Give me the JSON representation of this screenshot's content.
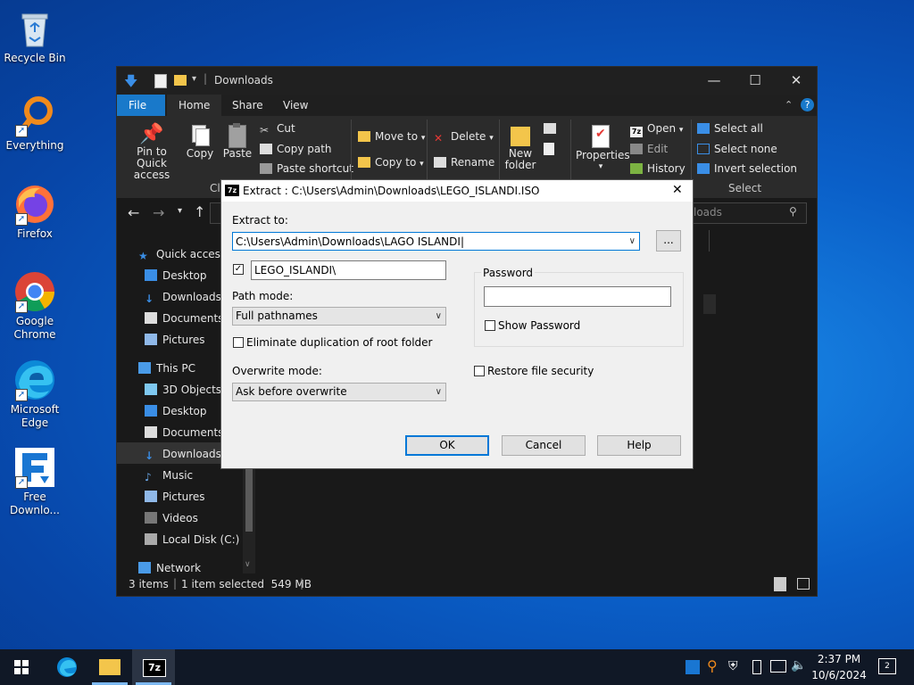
{
  "desktop": {
    "icons": [
      {
        "label": "Recycle Bin",
        "icon": "recycle-bin-icon"
      },
      {
        "label": "Everything",
        "icon": "everything-search-icon"
      },
      {
        "label": "Firefox",
        "icon": "firefox-icon"
      },
      {
        "label": "Google Chrome",
        "icon": "chrome-icon"
      },
      {
        "label": "Microsoft Edge",
        "icon": "edge-icon"
      },
      {
        "label": "Free Downlo...",
        "icon": "free-download-manager-icon"
      }
    ]
  },
  "explorer": {
    "title": "Downloads",
    "tabs": [
      "File",
      "Home",
      "Share",
      "View"
    ],
    "ribbon": {
      "pin_label": "Pin to Quick access",
      "copy_label": "Copy",
      "paste_label": "Paste",
      "cut_label": "Cut",
      "copy_path_label": "Copy path",
      "paste_shortcut_label": "Paste shortcut",
      "clip_label_partial": "Cli",
      "move_to_label": "Move to",
      "copy_to_label": "Copy to",
      "delete_label": "Delete",
      "rename_label": "Rename",
      "new_folder_label": "New folder",
      "properties_label": "Properties",
      "open_label": "Open",
      "edit_label": "Edit",
      "history_label": "History",
      "select_all_label": "Select all",
      "select_none_label": "Select none",
      "invert_selection_label": "Invert selection",
      "select_group_label": "Select"
    },
    "search_placeholder_partial": "loads",
    "nav": [
      {
        "label": "Quick access",
        "icon": "star-icon"
      },
      {
        "label": "Desktop",
        "icon": "desktop-folder-icon"
      },
      {
        "label": "Downloads",
        "icon": "download-arrow-icon"
      },
      {
        "label": "Documents",
        "icon": "documents-icon"
      },
      {
        "label": "Pictures",
        "icon": "pictures-icon"
      },
      {
        "label": "This PC",
        "icon": "computer-icon"
      },
      {
        "label": "3D Objects",
        "icon": "cube-icon"
      },
      {
        "label": "Desktop",
        "icon": "desktop-folder-icon"
      },
      {
        "label": "Documents",
        "icon": "documents-icon"
      },
      {
        "label": "Downloads",
        "icon": "download-arrow-icon"
      },
      {
        "label": "Music",
        "icon": "music-icon"
      },
      {
        "label": "Pictures",
        "icon": "pictures-icon"
      },
      {
        "label": "Videos",
        "icon": "videos-icon"
      },
      {
        "label": "Local Disk (C:)",
        "icon": "drive-icon"
      },
      {
        "label": "Network",
        "icon": "network-icon"
      }
    ],
    "status": {
      "items": "3 items",
      "selected": "1 item selected  549 MB"
    }
  },
  "dialog": {
    "title": "Extract : C:\\Users\\Admin\\Downloads\\LEGO_ISLANDI.ISO",
    "extract_to_label": "Extract to:",
    "extract_to_value": "C:\\Users\\Admin\\Downloads\\LAGO ISLANDI",
    "browse_label": "...",
    "subfolder_value": "LEGO_ISLANDI\\",
    "path_mode_label": "Path mode:",
    "path_mode_value": "Full pathnames",
    "eliminate_label": "Eliminate duplication of root folder",
    "overwrite_mode_label": "Overwrite mode:",
    "overwrite_mode_value": "Ask before overwrite",
    "password_label": "Password",
    "show_password_label": "Show Password",
    "restore_security_label": "Restore file security",
    "ok_label": "OK",
    "cancel_label": "Cancel",
    "help_label": "Help"
  },
  "taskbar": {
    "time": "2:37 PM",
    "date": "10/6/2024"
  },
  "colors": {
    "accent": "#1979ca",
    "dialog_default_border": "#0078d7"
  }
}
